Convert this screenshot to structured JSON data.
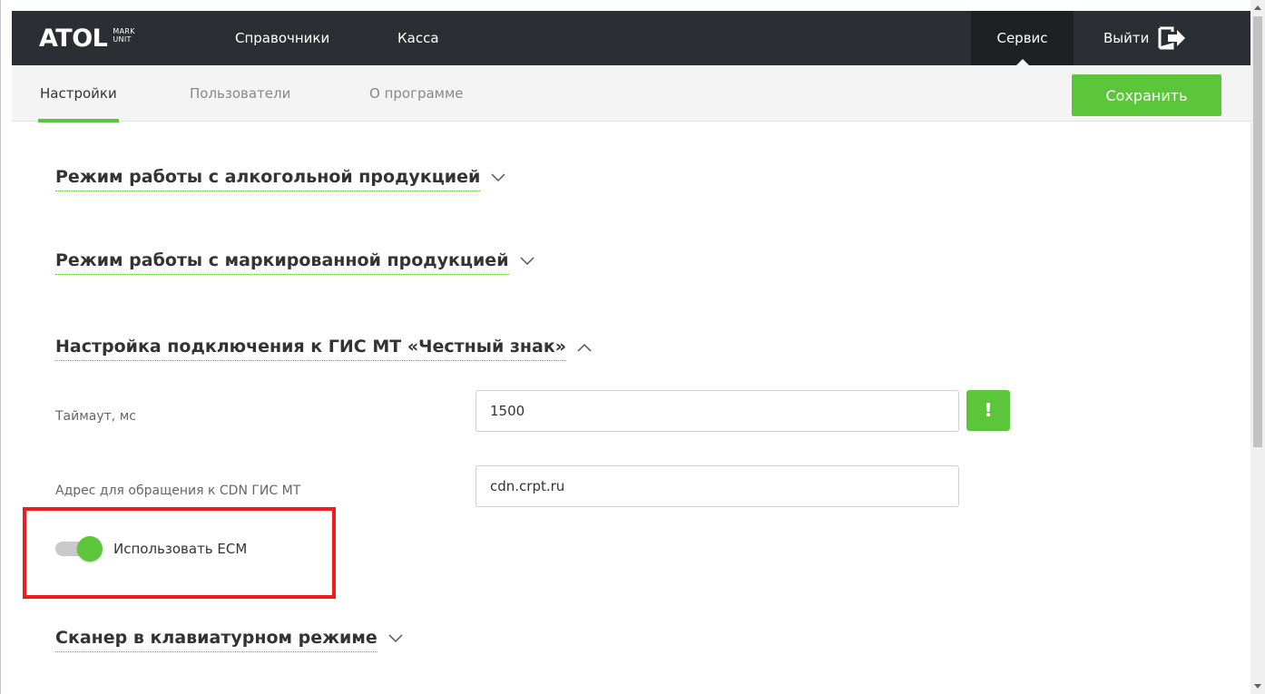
{
  "header": {
    "logo_main": "ATOL",
    "logo_sub1": "MARK",
    "logo_sub2": "UNIT",
    "nav": [
      "Справочники",
      "Касса"
    ],
    "service": "Сервис",
    "logout": "Выйти"
  },
  "subnav": {
    "tabs": [
      "Настройки",
      "Пользователи",
      "О программе"
    ],
    "active_tab": "Настройки",
    "save_label": "Сохранить"
  },
  "sections": {
    "alcohol": "Режим работы с алкогольной продукцией",
    "marked": "Режим работы с маркированной продукцией",
    "gis": "Настройка подключения к ГИС МТ «Честный знак»",
    "scanner": "Сканер в клавиатурном режиме"
  },
  "fields": {
    "timeout_label": "Таймаут, мс",
    "timeout_value": "1500",
    "cdn_label": "Адрес для обращения к CDN ГИС МТ",
    "cdn_value": "cdn.crpt.ru",
    "warn_symbol": "!"
  },
  "toggle": {
    "label": "Использовать ЕСМ",
    "on": true
  },
  "colors": {
    "accent": "#5cc63a",
    "header_bg": "#2b2f33",
    "highlight": "#ee1c1c"
  }
}
